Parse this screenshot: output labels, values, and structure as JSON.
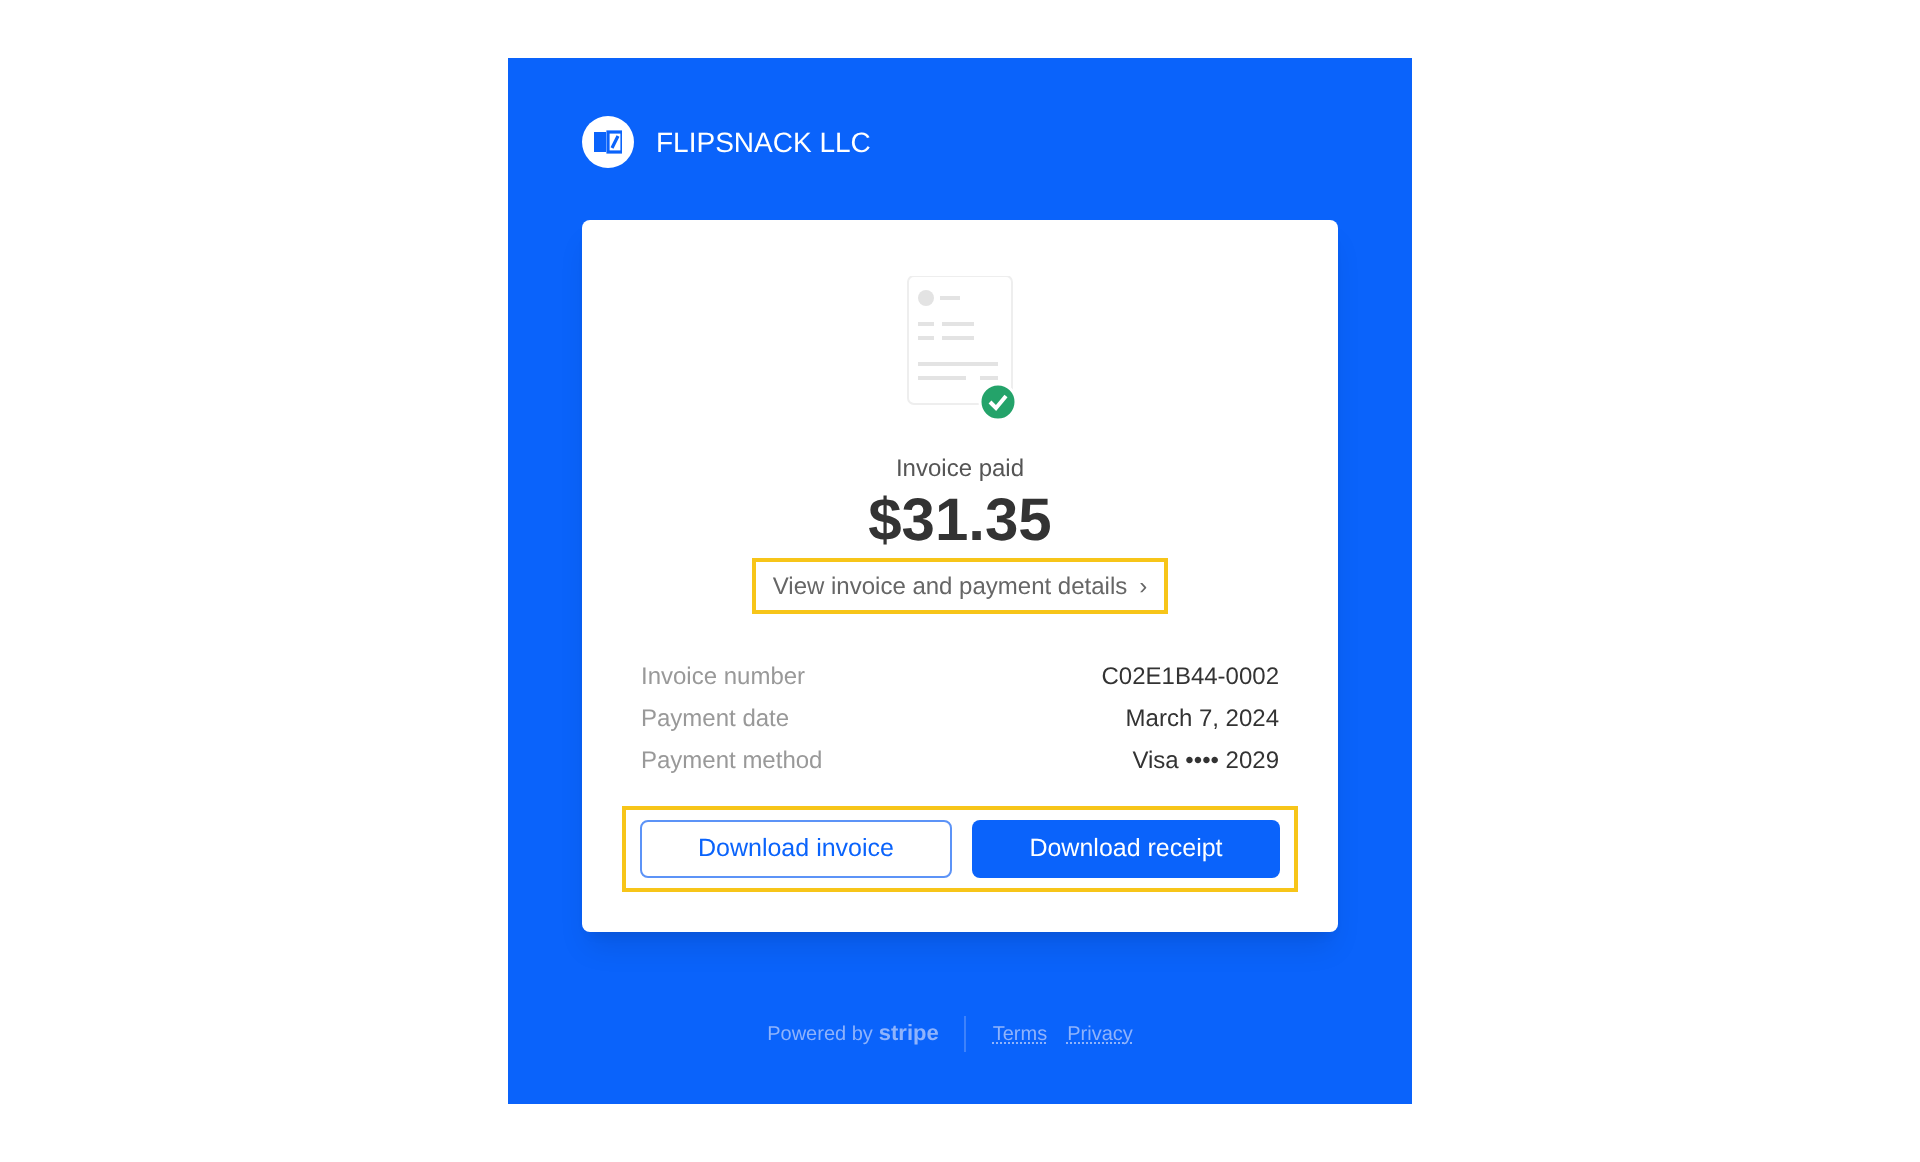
{
  "merchant": {
    "name": "FLIPSNACK LLC"
  },
  "status": {
    "label": "Invoice paid"
  },
  "amount": "$31.35",
  "details_link": {
    "label": "View invoice and payment details",
    "chevron": "›"
  },
  "details": [
    {
      "label": "Invoice number",
      "value": "C02E1B44-0002"
    },
    {
      "label": "Payment date",
      "value": "March 7, 2024"
    },
    {
      "label": "Payment method",
      "value": "Visa •••• 2029"
    }
  ],
  "buttons": [
    {
      "label": "Download invoice",
      "kind": "outline"
    },
    {
      "label": "Download receipt",
      "kind": "primary"
    }
  ],
  "footer": {
    "powered_by": "Powered by",
    "brand": "stripe",
    "links": [
      "Terms",
      "Privacy"
    ]
  }
}
